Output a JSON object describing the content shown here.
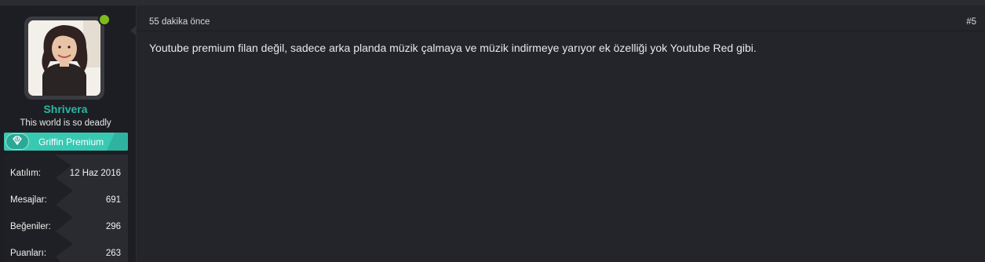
{
  "user": {
    "username": "Shrivera",
    "title": "This world is so deadly",
    "banner": "Griffin Premium",
    "online": true,
    "stats": [
      {
        "label": "Katılım:",
        "value": "12 Haz 2016"
      },
      {
        "label": "Mesajlar:",
        "value": "691"
      },
      {
        "label": "Beğeniler:",
        "value": "296"
      },
      {
        "label": "Puanları:",
        "value": "263"
      }
    ]
  },
  "post": {
    "date": "55 dakika önce",
    "number": "#5",
    "message": "Youtube premium filan değil, sadece arka planda müzik çalmaya ve müzik indirmeye yarıyor ek özelliği yok Youtube Red gibi."
  },
  "colors": {
    "accent": "#2ab8a1",
    "banner": "#38c9b3",
    "online": "#7fba1d",
    "background": "#1d1e23",
    "post_bg": "#24252b"
  }
}
